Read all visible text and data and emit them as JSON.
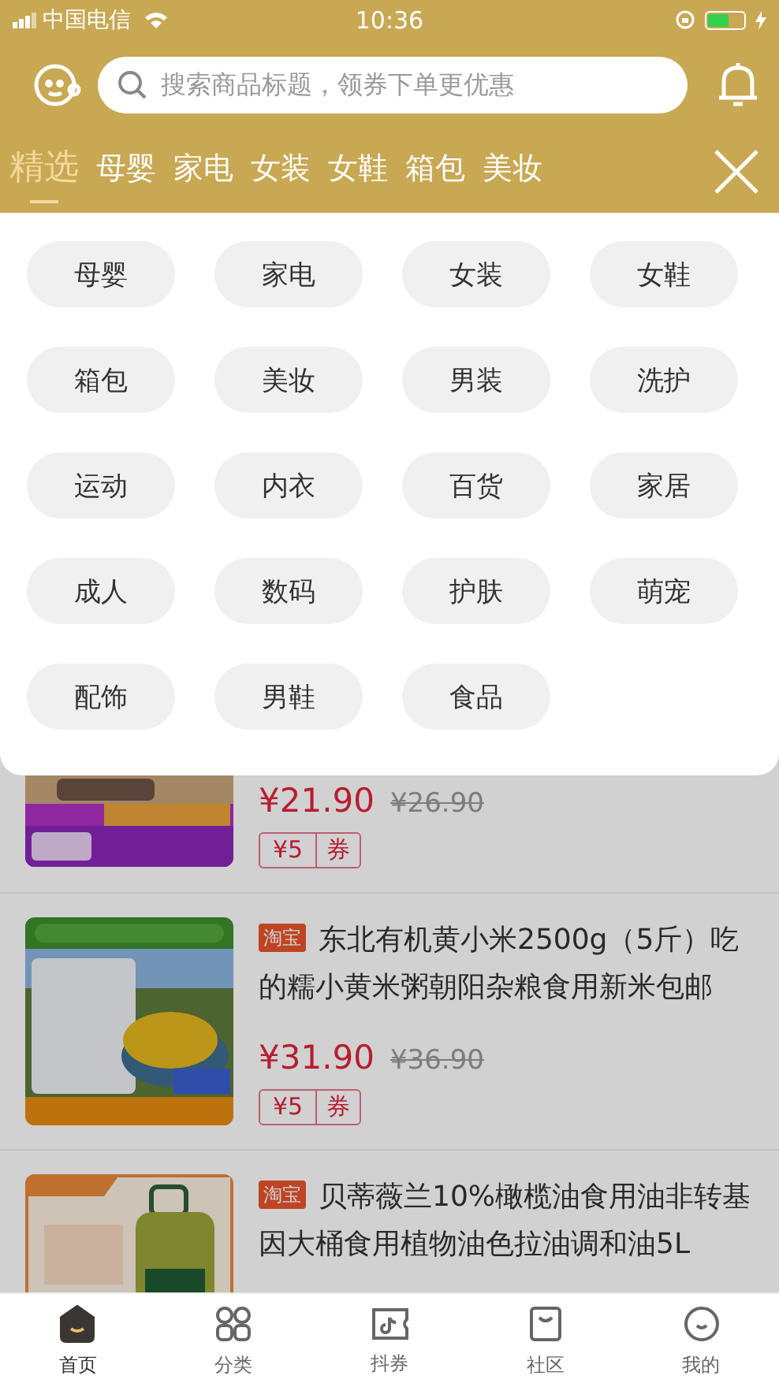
{
  "status_bar": {
    "carrier": "中国电信",
    "time": "10:36"
  },
  "search": {
    "placeholder": "搜索商品标题，领券下单更优惠"
  },
  "tabs": [
    {
      "label": "精选",
      "selected": true
    },
    {
      "label": "母婴",
      "selected": false
    },
    {
      "label": "家电",
      "selected": false
    },
    {
      "label": "女装",
      "selected": false
    },
    {
      "label": "女鞋",
      "selected": false
    },
    {
      "label": "箱包",
      "selected": false
    },
    {
      "label": "美妆",
      "selected": false
    }
  ],
  "category_panel": {
    "items": [
      "母婴",
      "家电",
      "女装",
      "女鞋",
      "箱包",
      "美妆",
      "男装",
      "洗护",
      "运动",
      "内衣",
      "百货",
      "家居",
      "成人",
      "数码",
      "护肤",
      "萌宠",
      "配饰",
      "男鞋",
      "食品"
    ]
  },
  "products": [
    {
      "kind": "picture",
      "price": "¥21.90",
      "original_price": "¥26.90",
      "coupon": {
        "amount": "¥5",
        "label": "券"
      }
    },
    {
      "kind": "picture",
      "platform": "淘宝",
      "title": "东北有机黄小米2500g（5斤）吃的糯小黄米粥朝阳杂粮食用新米包邮",
      "price": "¥31.90",
      "original_price": "¥36.90",
      "coupon": {
        "amount": "¥5",
        "label": "券"
      }
    },
    {
      "kind": "picture",
      "platform": "淘宝",
      "title": "贝蒂薇兰10%橄榄油食用油非转基因大桶食用植物油色拉油调和油5L"
    }
  ],
  "bottom_nav": [
    {
      "label": "首页",
      "selected": true
    },
    {
      "label": "分类",
      "selected": false
    },
    {
      "label": "抖券",
      "selected": false
    },
    {
      "label": "社区",
      "selected": false
    },
    {
      "label": "我的",
      "selected": false
    }
  ]
}
